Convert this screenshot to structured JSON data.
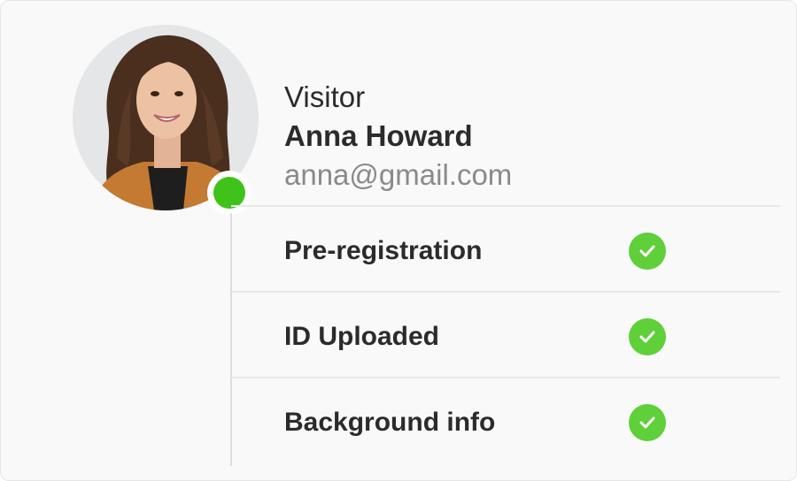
{
  "visitor": {
    "role": "Visitor",
    "name": "Anna Howard",
    "email": "anna@gmail.com",
    "status": "online",
    "status_color": "#3fc21a"
  },
  "steps": [
    {
      "label": "Pre-registration",
      "status": "complete",
      "icon": "check-icon"
    },
    {
      "label": "ID Uploaded",
      "status": "complete",
      "icon": "check-icon"
    },
    {
      "label": "Background info",
      "status": "complete",
      "icon": "check-icon"
    }
  ],
  "colors": {
    "check_green": "#5fcf3a",
    "text": "#2b2b2b",
    "muted": "#8a8a8a"
  }
}
